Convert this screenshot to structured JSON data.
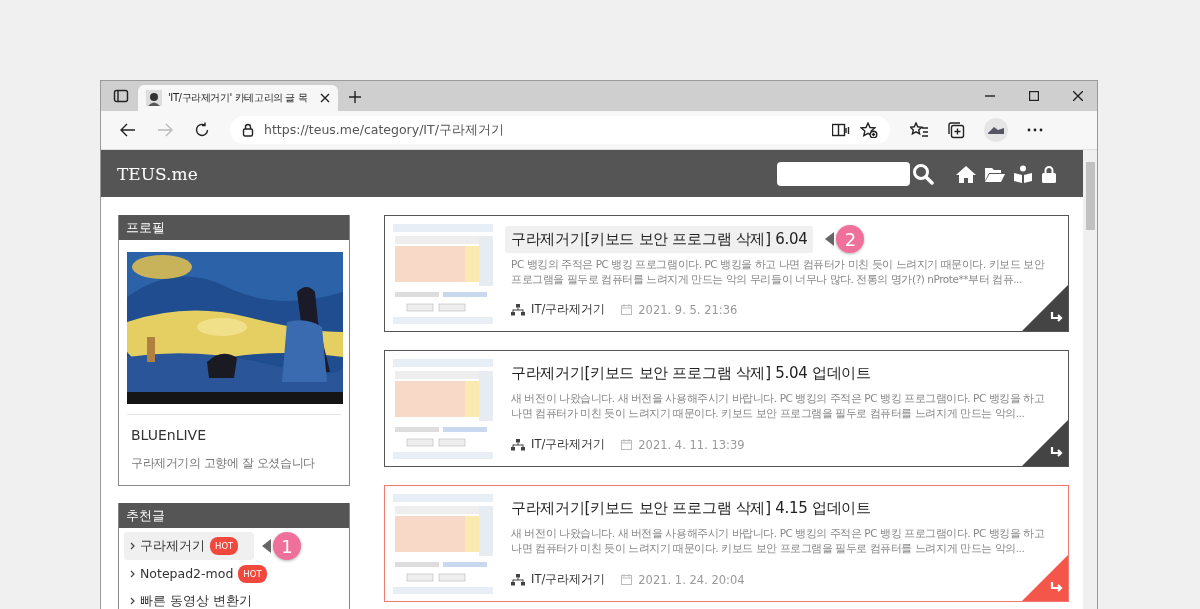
{
  "browser": {
    "tab_title": "'IT/구라제거기' 카테고리의 글 목",
    "url": "https://teus.me/category/IT/구라제거기"
  },
  "site": {
    "title": "TEUS.me"
  },
  "sidebar": {
    "profile": {
      "heading": "프로필",
      "name": "BLUEnLIVE",
      "description": "구라제거기의 고향에 잘 오셨습니다"
    },
    "recommended": {
      "heading": "추천글",
      "items": [
        {
          "label": "구라제거기",
          "badge": "HOT",
          "highlighted": true,
          "callout": "1"
        },
        {
          "label": "Notepad2-mod",
          "badge": "HOT",
          "highlighted": false
        },
        {
          "label": "빠른 동영상 변환기",
          "highlighted": false
        }
      ]
    }
  },
  "posts": [
    {
      "title": "구라제거기[키보드 보안 프로그램 삭제] 6.04",
      "excerpt": "PC 뱅킹의 주적은 PC 뱅킹 프로그램이다. PC 뱅킹을 하고 나면 컴퓨터가 미친 듯이 느려지기 때문이다. 키보드 보안 프로그램을 필두로 컴퓨터를 느려지게 만드는 악의 무리들이 너무나 많다. 전통의 명가(?) nProte**부터 컴퓨...",
      "category": "IT/구라제거기",
      "date": "2021. 9. 5. 21:36",
      "title_highlighted": true,
      "accent": false,
      "callout": "2"
    },
    {
      "title": "구라제거기[키보드 보안 프로그램 삭제] 5.04 업데이트",
      "excerpt": "새 버전이 나왔습니다. 새 버전을 사용해주시기 바랍니다. PC 뱅킹의 주적은 PC 뱅킹 프로그램이다. PC 뱅킹을 하고 나면 컴퓨터가 미친 듯이 느려지기 때문이다. 키보드 보안 프로그램을 필두로 컴퓨터를 느려지게 만드는 악의...",
      "category": "IT/구라제거기",
      "date": "2021. 4. 11. 13:39",
      "title_highlighted": false,
      "accent": false
    },
    {
      "title": "구라제거기[키보드 보안 프로그램 삭제] 4.15 업데이트",
      "excerpt": "새 버전이 나왔습니다. 새 버전을 사용해주시기 바랍니다. PC 뱅킹의 주적은 PC 뱅킹 프로그램이다. PC 뱅킹을 하고 나면 컴퓨터가 미친 듯이 느려지기 때문이다. 키보드 보안 프로그램을 필두로 컴퓨터를 느려지게 만드는 악의...",
      "category": "IT/구라제거기",
      "date": "2021. 1. 24. 20:04",
      "title_highlighted": false,
      "accent": true
    }
  ]
}
